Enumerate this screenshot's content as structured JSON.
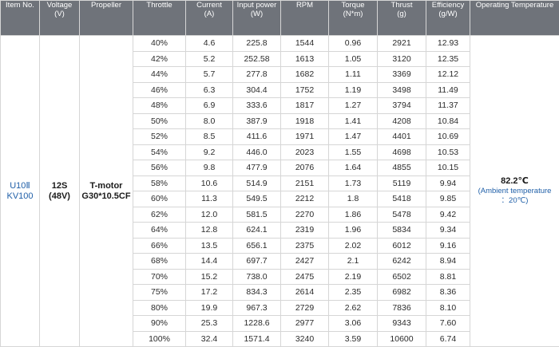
{
  "headers": [
    {
      "label": "Item No.",
      "unit": ""
    },
    {
      "label": "Voltage",
      "unit": "(V)"
    },
    {
      "label": "Propeller",
      "unit": ""
    },
    {
      "label": "Throttle",
      "unit": ""
    },
    {
      "label": "Current",
      "unit": "(A)"
    },
    {
      "label": "Input power",
      "unit": "(W)"
    },
    {
      "label": "RPM",
      "unit": ""
    },
    {
      "label": "Torque",
      "unit": "(N*m)"
    },
    {
      "label": "Thrust",
      "unit": "(g)"
    },
    {
      "label": "Efficiency",
      "unit": "(g/W)"
    },
    {
      "label": "Operating Temperature",
      "unit": ""
    }
  ],
  "item_no": [
    "U10Ⅱ",
    "KV100"
  ],
  "voltage": [
    "12S",
    "(48V)"
  ],
  "propeller": [
    "T-motor",
    "G30*10.5CF"
  ],
  "temperature": {
    "value": "82.2℃",
    "note_1": "(Ambient temperature",
    "note_2": "：20℃)"
  },
  "rows": [
    [
      "40%",
      "4.6",
      "225.8",
      "1544",
      "0.96",
      "2921",
      "12.93"
    ],
    [
      "42%",
      "5.2",
      "252.58",
      "1613",
      "1.05",
      "3120",
      "12.35"
    ],
    [
      "44%",
      "5.7",
      "277.8",
      "1682",
      "1.11",
      "3369",
      "12.12"
    ],
    [
      "46%",
      "6.3",
      "304.4",
      "1752",
      "1.19",
      "3498",
      "11.49"
    ],
    [
      "48%",
      "6.9",
      "333.6",
      "1817",
      "1.27",
      "3794",
      "11.37"
    ],
    [
      "50%",
      "8.0",
      "387.9",
      "1918",
      "1.41",
      "4208",
      "10.84"
    ],
    [
      "52%",
      "8.5",
      "411.6",
      "1971",
      "1.47",
      "4401",
      "10.69"
    ],
    [
      "54%",
      "9.2",
      "446.0",
      "2023",
      "1.55",
      "4698",
      "10.53"
    ],
    [
      "56%",
      "9.8",
      "477.9",
      "2076",
      "1.64",
      "4855",
      "10.15"
    ],
    [
      "58%",
      "10.6",
      "514.9",
      "2151",
      "1.73",
      "5119",
      "9.94"
    ],
    [
      "60%",
      "11.3",
      "549.5",
      "2212",
      "1.8",
      "5418",
      "9.85"
    ],
    [
      "62%",
      "12.0",
      "581.5",
      "2270",
      "1.86",
      "5478",
      "9.42"
    ],
    [
      "64%",
      "12.8",
      "624.1",
      "2319",
      "1.96",
      "5834",
      "9.34"
    ],
    [
      "66%",
      "13.5",
      "656.1",
      "2375",
      "2.02",
      "6012",
      "9.16"
    ],
    [
      "68%",
      "14.4",
      "697.7",
      "2427",
      "2.1",
      "6242",
      "8.94"
    ],
    [
      "70%",
      "15.2",
      "738.0",
      "2475",
      "2.19",
      "6502",
      "8.81"
    ],
    [
      "75%",
      "17.2",
      "834.3",
      "2614",
      "2.35",
      "6982",
      "8.36"
    ],
    [
      "80%",
      "19.9",
      "967.3",
      "2729",
      "2.62",
      "7836",
      "8.10"
    ],
    [
      "90%",
      "25.3",
      "1228.6",
      "2977",
      "3.06",
      "9343",
      "7.60"
    ],
    [
      "100%",
      "32.4",
      "1571.4",
      "3240",
      "3.59",
      "10600",
      "6.74"
    ]
  ]
}
